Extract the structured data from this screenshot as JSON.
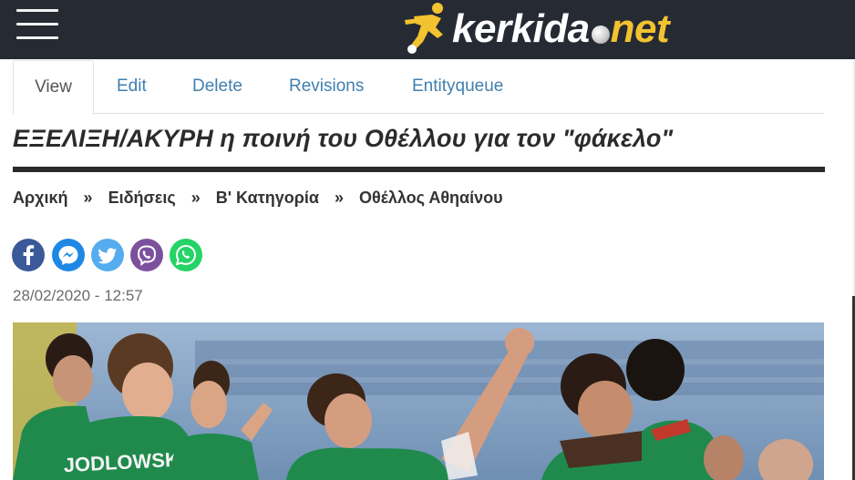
{
  "header": {
    "menu_icon": "hamburger-menu-icon",
    "logo": {
      "part1": "kerkida",
      "part2": "net",
      "icon": "football-player-icon",
      "brand_yellow": "#f2c230"
    },
    "background_color": "#262a33"
  },
  "tabs": [
    {
      "label": "View",
      "active": true
    },
    {
      "label": "Edit"
    },
    {
      "label": "Delete"
    },
    {
      "label": "Revisions"
    },
    {
      "label": "Entityqueue"
    }
  ],
  "article": {
    "title": "ΕΞΕΛΙΞΗ/ΑΚΥΡΗ η ποινή του Οθέλλου για τον \"φάκελο\"",
    "breadcrumb": [
      "Αρχική",
      "Ειδήσεις",
      "Β' Κατηγορία",
      "Οθέλλος Αθηαίνου"
    ],
    "breadcrumb_separator": "»",
    "share_icons": [
      "facebook-icon",
      "messenger-icon",
      "twitter-icon",
      "viber-icon",
      "whatsapp-icon"
    ],
    "date": "28/02/2020 - 12:57",
    "photo": {
      "jersey_text": "JODLOWSKI",
      "team_color": "#1f8a4c"
    }
  }
}
